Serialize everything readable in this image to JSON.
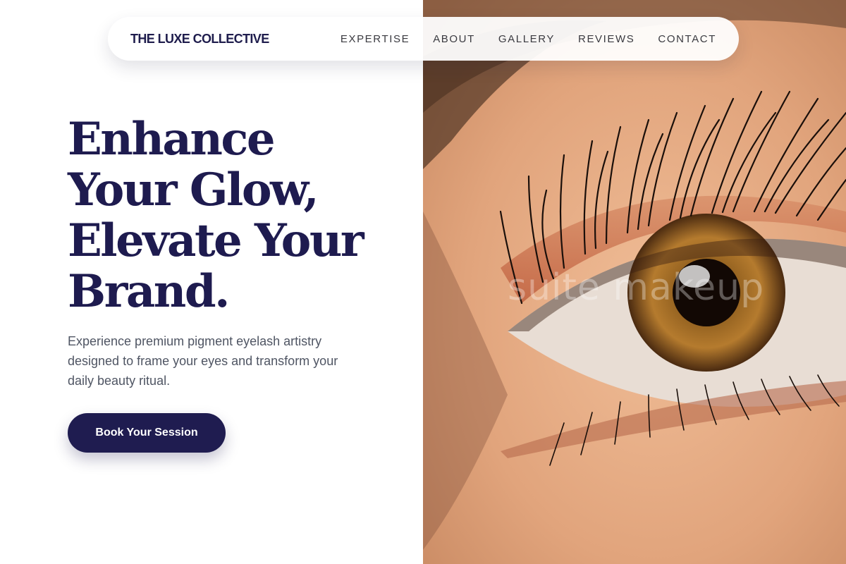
{
  "nav": {
    "brand": "THE LUXE COLLECTIVE",
    "links": [
      "EXPERTISE",
      "ABOUT",
      "GALLERY",
      "REVIEWS",
      "CONTACT"
    ]
  },
  "hero": {
    "headline_lines": [
      "Enhance",
      "Your Glow,",
      "Elevate Your",
      "Brand."
    ],
    "subtext": "Experience premium pigment eyelash artistry designed to frame your eyes and transform your daily beauty ritual.",
    "cta_label": "Book Your Session",
    "image_watermark": "suite makeup"
  },
  "colors": {
    "primary": "#1f1c50",
    "headline": "#1e1b4f",
    "body_text": "#4f5563",
    "nav_text": "#3a3a40",
    "background": "#ffffff"
  }
}
